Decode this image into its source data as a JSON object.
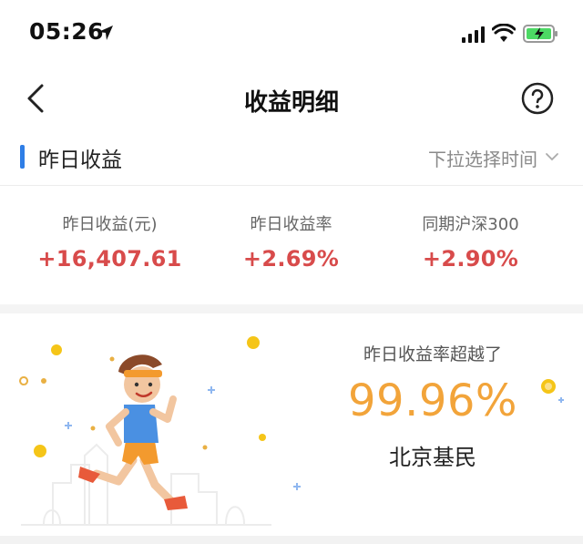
{
  "status_bar": {
    "time": "05:26",
    "icons": [
      "location-arrow-icon",
      "cellular-signal-icon",
      "wifi-icon",
      "battery-charging-icon"
    ]
  },
  "nav": {
    "title": "收益明细",
    "back_icon": "chevron-left-icon",
    "help_icon": "question-circle-icon"
  },
  "section": {
    "title": "昨日收益",
    "picker_label": "下拉选择时间",
    "picker_icon": "chevron-down-icon",
    "accent_color": "#2f7ee6"
  },
  "stats": [
    {
      "label": "昨日收益(元)",
      "value": "+16,407.61"
    },
    {
      "label": "昨日收益率",
      "value": "+2.69%"
    },
    {
      "label": "同期沪深300",
      "value": "+2.90%"
    }
  ],
  "banner": {
    "caption": "昨日收益率超越了",
    "percent": "99.96%",
    "group": "北京基民",
    "colors": {
      "percent": "#f2a43a",
      "gain": "#d84b4b"
    }
  }
}
